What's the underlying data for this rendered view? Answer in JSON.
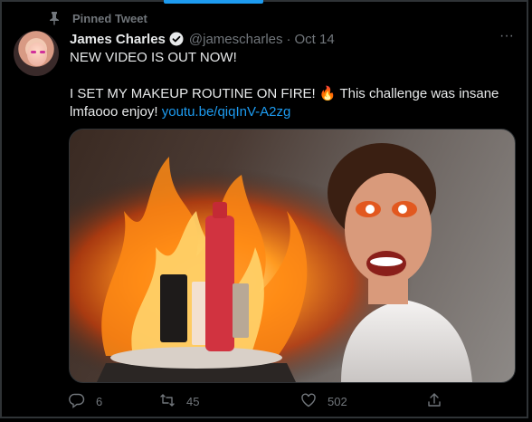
{
  "pinned": {
    "label": "Pinned Tweet",
    "icon": "pin-icon"
  },
  "tweet": {
    "author": {
      "name": "James Charles",
      "handle": "@jamescharles",
      "verified": true
    },
    "date": "Oct 14",
    "separator": "·",
    "more_label": "···",
    "text": {
      "line1": "NEW VIDEO IS OUT NOW!",
      "line2": "I SET MY MAKEUP ROUTINE ON FIRE! 🔥 This challenge was insane",
      "line3_text": "lmfaooo enjoy! ",
      "link": "youtu.be/qiqInV-A2zg"
    },
    "media": {
      "description_icon": "video-thumbnail"
    }
  },
  "actions": {
    "replies": "6",
    "retweets": "45",
    "likes": "502"
  },
  "colors": {
    "background": "#000000",
    "text": "#e7e9ea",
    "muted": "#71767b",
    "accent": "#1d9bf0"
  }
}
